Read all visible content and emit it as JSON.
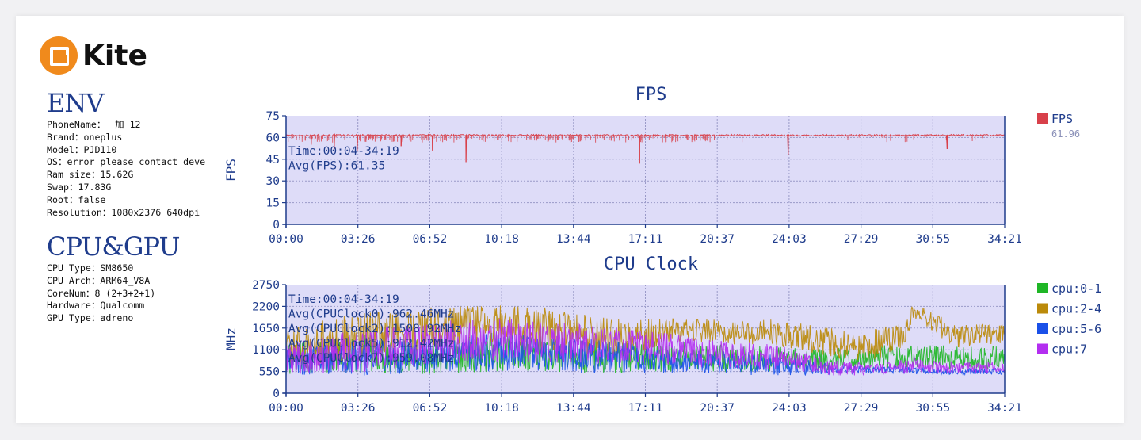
{
  "logo": {
    "text": "Kite"
  },
  "env": {
    "title": "ENV",
    "lines": [
      "PhoneName：一加 12",
      "Brand：oneplus",
      "Model：PJD110",
      "OS：error please contact deve",
      "Ram size：15.62G",
      "Swap：17.83G",
      "Root：false",
      "Resolution：1080x2376 640dpi"
    ]
  },
  "cpugpu": {
    "title": "CPU&GPU",
    "lines": [
      "CPU Type：SM8650",
      "CPU Arch：ARM64_V8A",
      "CoreNum：8 (2+3+2+1)",
      "Hardware：Qualcomm",
      "GPU Type：adreno"
    ]
  },
  "colors": {
    "plot_bg": "#dedcf8",
    "axis": "#1f3c8c",
    "fps": "#d8404a",
    "cpu01": "#1fb626",
    "cpu24": "#bb8a0a",
    "cpu56": "#1a50e8",
    "cpu7": "#b32ef0"
  },
  "chart_data": [
    {
      "type": "line",
      "title": "FPS",
      "ylabel": "FPS",
      "xlabel": "",
      "ylim": [
        0,
        75
      ],
      "yticks": [
        "0",
        "15",
        "30",
        "45",
        "60",
        "75"
      ],
      "xticks": [
        "00:00",
        "03:26",
        "06:52",
        "10:18",
        "13:44",
        "17:11",
        "20:37",
        "24:03",
        "27:29",
        "30:55",
        "34:21"
      ],
      "grid": true,
      "legend_position": "right",
      "annotations": [
        "Time:00:04-34:19",
        "Avg(FPS):61.35"
      ],
      "series": [
        {
          "name": "FPS",
          "legend_value": "61.96",
          "color": "#d8404a",
          "baseline": 61.5,
          "x_minutes": [
            0.0,
            0.5,
            1.0,
            1.2,
            2.0,
            2.3,
            3.0,
            3.4,
            4.0,
            5.0,
            5.5,
            6.0,
            6.5,
            7.0,
            7.5,
            8.0,
            8.6,
            9.0,
            9.5,
            10.0,
            11.0,
            12.0,
            13.0,
            14.0,
            15.0,
            16.0,
            16.9,
            17.5,
            18.0,
            19.0,
            20.0,
            21.0,
            22.0,
            23.5,
            24.0,
            25.0,
            26.0,
            27.0,
            28.0,
            29.0,
            30.0,
            31.0,
            31.6,
            32.0,
            33.0,
            34.0,
            34.35
          ],
          "y": [
            61,
            60,
            61,
            55,
            61,
            52,
            61,
            51,
            60,
            61,
            54,
            60,
            61,
            51,
            60,
            61,
            43,
            59,
            60,
            59,
            60,
            60,
            59,
            60,
            60,
            60,
            42,
            60,
            61,
            61,
            61,
            60,
            61,
            61,
            48,
            61,
            61,
            61,
            61,
            61,
            61,
            61,
            52,
            61,
            61,
            61,
            61
          ]
        }
      ]
    },
    {
      "type": "line",
      "title": "CPU Clock",
      "ylabel": "MHz",
      "xlabel": "",
      "ylim": [
        0,
        2750
      ],
      "yticks": [
        "0",
        "550",
        "1100",
        "1650",
        "2200",
        "2750"
      ],
      "xticks": [
        "00:00",
        "03:26",
        "06:52",
        "10:18",
        "13:44",
        "17:11",
        "20:37",
        "24:03",
        "27:29",
        "30:55",
        "34:21"
      ],
      "grid": true,
      "legend_position": "right",
      "annotations": [
        "Time:00:04-34:19",
        "Avg(CPUClock0):962.46MHz",
        "Avg(CPUClock2):1508.92MHz",
        "Avg(CPUClock5):912.42MHz",
        "Avg(CPUClock7):959.08MHz"
      ],
      "series": [
        {
          "name": "cpu:0-1",
          "color": "#1fb626",
          "x_minutes": [
            0,
            2,
            4,
            6,
            8,
            10,
            12,
            14,
            16,
            18,
            20,
            22,
            24,
            26,
            28,
            30,
            32,
            34.3
          ],
          "y": [
            850,
            950,
            1000,
            900,
            950,
            1050,
            1000,
            950,
            900,
            950,
            900,
            850,
            900,
            850,
            900,
            950,
            900,
            900
          ],
          "spread": [
            400,
            450,
            500,
            450,
            450,
            500,
            450,
            450,
            400,
            400,
            350,
            350,
            300,
            300,
            300,
            300,
            300,
            300
          ]
        },
        {
          "name": "cpu:2-4",
          "color": "#bb8a0a",
          "x_minutes": [
            0,
            2,
            4,
            6,
            8,
            10,
            12,
            14,
            16,
            18,
            20,
            22,
            23,
            24,
            26,
            28,
            29.5,
            30,
            32,
            34.3
          ],
          "y": [
            1100,
            1300,
            1450,
            1600,
            1700,
            1750,
            1650,
            1500,
            1400,
            1550,
            1600,
            1500,
            1600,
            1450,
            1300,
            1200,
            1500,
            2100,
            1450,
            1500
          ],
          "spread": [
            500,
            600,
            600,
            550,
            500,
            500,
            550,
            550,
            500,
            350,
            300,
            300,
            300,
            350,
            400,
            400,
            350,
            200,
            300,
            250
          ]
        },
        {
          "name": "cpu:5-6",
          "color": "#1a50e8",
          "x_minutes": [
            0,
            2,
            4,
            6,
            8,
            10,
            12,
            14,
            16,
            18,
            20,
            22,
            24,
            26,
            28,
            30,
            32,
            34.3
          ],
          "y": [
            750,
            850,
            900,
            950,
            1000,
            1050,
            1000,
            950,
            900,
            850,
            800,
            750,
            700,
            600,
            600,
            580,
            550,
            550
          ],
          "spread": [
            350,
            400,
            450,
            450,
            450,
            500,
            450,
            450,
            400,
            350,
            300,
            300,
            250,
            150,
            100,
            100,
            80,
            80
          ]
        },
        {
          "name": "cpu:7",
          "color": "#b32ef0",
          "x_minutes": [
            0,
            2,
            4,
            6,
            8,
            10,
            12,
            14,
            16,
            18,
            20,
            22,
            24,
            26,
            28,
            30,
            32,
            34.3
          ],
          "y": [
            850,
            1000,
            1100,
            1200,
            1300,
            1350,
            1300,
            1250,
            1200,
            1150,
            1000,
            950,
            900,
            650,
            600,
            700,
            650,
            650
          ],
          "spread": [
            400,
            500,
            550,
            550,
            550,
            550,
            550,
            500,
            450,
            400,
            350,
            350,
            300,
            200,
            150,
            200,
            150,
            150
          ]
        }
      ]
    }
  ]
}
